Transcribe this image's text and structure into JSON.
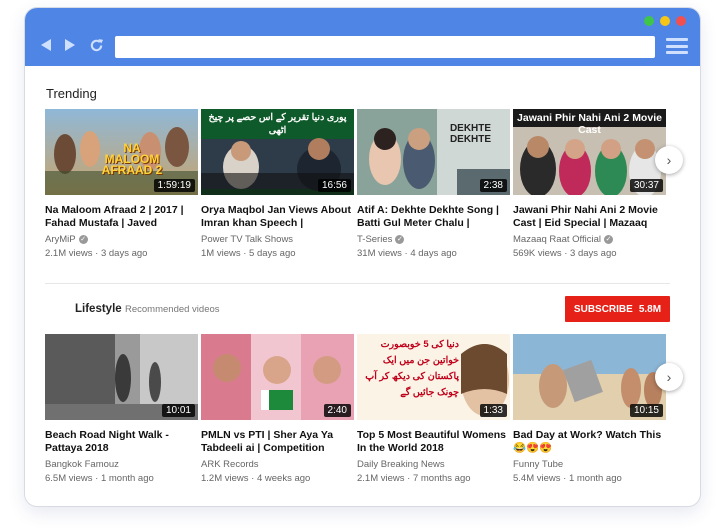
{
  "trending": {
    "title": "Trending",
    "videos": [
      {
        "title": "Na Maloom Afraad 2 | 2017 | Fahad Mustafa | Javed",
        "channel": "AryMiP",
        "verified": true,
        "views": "2.1M views",
        "age": "3 days ago",
        "duration": "1:59:19",
        "thumb_text": "NA MALOOM AFRAAD 2"
      },
      {
        "title": "Orya Maqbol Jan Views About Imran khan Speech |",
        "channel": "Power TV Talk Shows",
        "verified": false,
        "views": "1M views",
        "age": "5 days ago",
        "duration": "16:56",
        "thumb_text": "پوری دنیا تقریر کے اس حصے پر چیخ اٹھی"
      },
      {
        "title": "Atif A: Dekhte Dekhte Song | Batti Gul Meter Chalu |",
        "channel": "T-Series",
        "verified": true,
        "views": "31M views",
        "age": "4 days ago",
        "duration": "2:38",
        "thumb_text": "DEKHTE DEKHTE"
      },
      {
        "title": "Jawani Phir Nahi Ani 2 Movie Cast | Eid Special | Mazaaq",
        "channel": "Mazaaq Raat Official",
        "verified": true,
        "views": "569K views",
        "age": "3 days ago",
        "duration": "30:37",
        "thumb_text": "Jawani Phir Nahi Ani 2 Movie Cast"
      }
    ]
  },
  "lifestyle": {
    "title": "Lifestyle",
    "subtitle": "Recommended videos",
    "subscribe_label": "SUBSCRIBE",
    "subscriber_count": "5.8M",
    "videos": [
      {
        "title": "Beach Road Night Walk - Pattaya 2018",
        "channel": "Bangkok Famouz",
        "views": "6.5M views",
        "age": "1 month ago",
        "duration": "10:01"
      },
      {
        "title": "PMLN vs PTI | Sher Aya Ya Tabdeeli ai | Competition",
        "channel": "ARK Records",
        "views": "1.2M views",
        "age": "4 weeks ago",
        "duration": "2:40"
      },
      {
        "title": "Top 5 Most Beautiful Womens In the World 2018",
        "channel": "Daily Breaking News",
        "views": "2.1M views",
        "age": "7 months ago",
        "duration": "1:33",
        "thumb_text": "دنیا کی 5 خوبصورت خواتین جن میں ایک پاکستان کی دیکھ کر آپ چونک جائیں گے"
      },
      {
        "title": "Bad Day at Work? Watch This 😂😍😍",
        "channel": "Funny Tube",
        "views": "5.4M views",
        "age": "1 month ago",
        "duration": "10:15"
      }
    ]
  },
  "colors": {
    "titlebar": "#4f86e6",
    "subscribe": "#e62117",
    "dot_green": "#3fc54a",
    "dot_yellow": "#f5c518",
    "dot_red": "#f24f4f"
  },
  "icons": [
    "back-arrow-icon",
    "forward-arrow-icon",
    "refresh-icon",
    "hamburger-menu-icon",
    "verified-check-icon",
    "chevron-right-icon"
  ]
}
